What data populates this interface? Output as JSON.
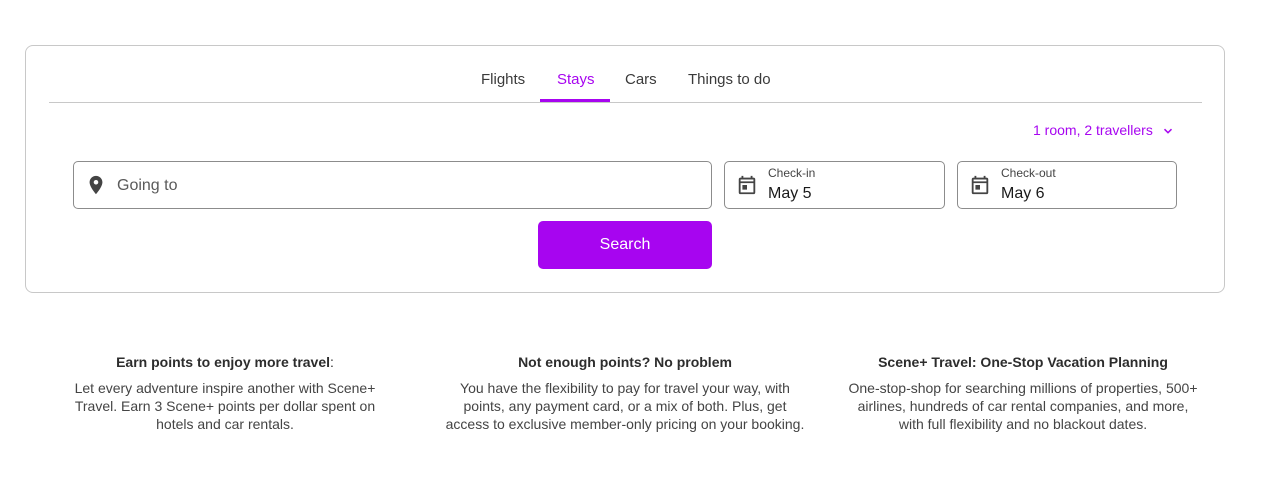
{
  "tabs": [
    {
      "label": "Flights",
      "active": false
    },
    {
      "label": "Stays",
      "active": true
    },
    {
      "label": "Cars",
      "active": false
    },
    {
      "label": "Things to do",
      "active": false
    }
  ],
  "travellers": {
    "label": "1 room, 2 travellers",
    "icon": "chevron-down-icon"
  },
  "destination": {
    "placeholder": "Going to",
    "icon": "map-pin-icon"
  },
  "check_in": {
    "label": "Check-in",
    "value": "May 5",
    "icon": "calendar-icon"
  },
  "check_out": {
    "label": "Check-out",
    "value": "May 6",
    "icon": "calendar-icon"
  },
  "search_button": {
    "label": "Search"
  },
  "features": [
    {
      "title": "Earn points to enjoy more travel",
      "title_suffix": ":",
      "text": "Let every adventure inspire another with Scene+ Travel. Earn 3 Scene+ points per dollar spent on hotels and car rentals."
    },
    {
      "title": "Not enough points? No problem",
      "title_suffix": "",
      "text": "You have the flexibility to pay for travel your way, with points, any payment card, or a mix of both. Plus, get access to exclusive member-only pricing on your booking."
    },
    {
      "title": "Scene+ Travel: One-Stop Vacation Planning",
      "title_suffix": "",
      "text": "One-stop-shop for searching millions of properties, 500+ airlines, hundreds of car rental companies, and more, with full flexibility and no blackout dates."
    }
  ],
  "colors": {
    "accent": "#a705f0",
    "border": "#c8c8c8",
    "icon": "#444444"
  }
}
